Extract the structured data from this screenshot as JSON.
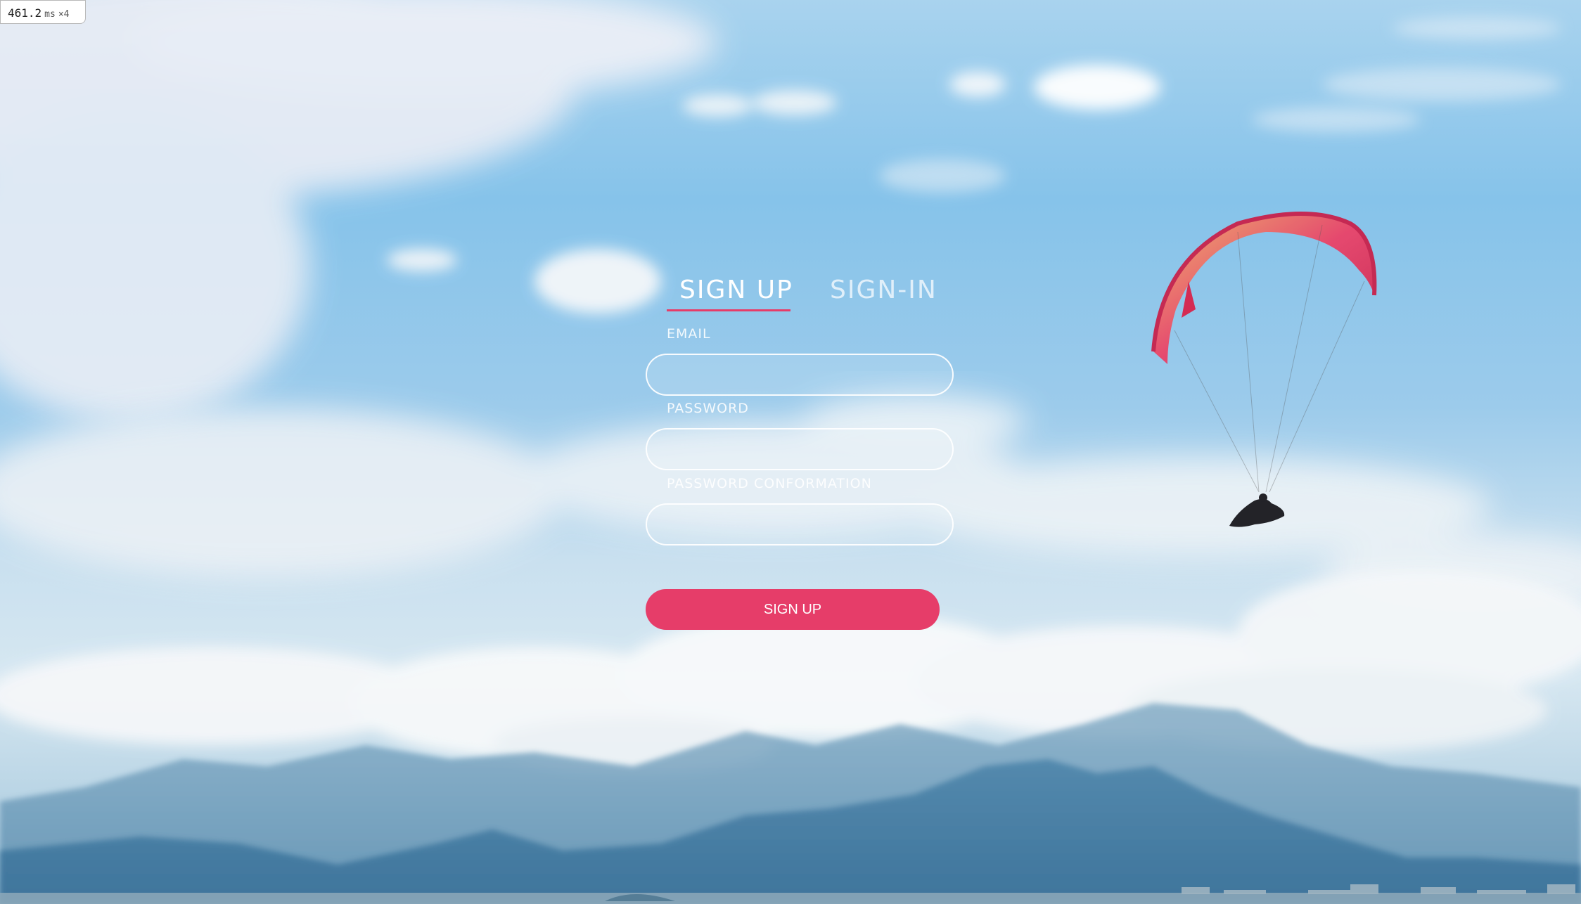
{
  "timer": {
    "value": "461.2",
    "unit": "ms",
    "multiplier": "×4"
  },
  "tabs": {
    "signup": "SIGN UP",
    "signin": "SIGN-IN",
    "active": "signup"
  },
  "form": {
    "email_label": "EMAIL",
    "email_value": "",
    "password_label": "PASSWORD",
    "password_value": "",
    "confirm_label": "PASSWORD CONFORMATION",
    "confirm_value": "",
    "submit_label": "SIGN UP"
  },
  "colors": {
    "accent": "#e63d69",
    "text": "#ffffff"
  },
  "background": {
    "scene": "sky-clouds-mountains-paraglider"
  }
}
